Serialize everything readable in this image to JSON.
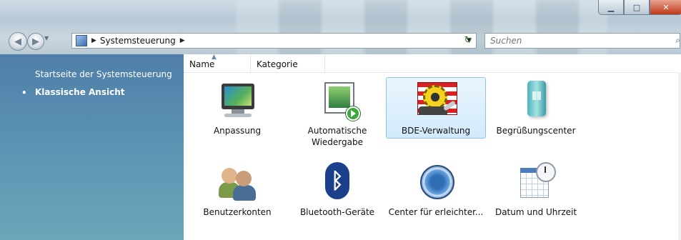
{
  "window": {
    "controls": [
      "minimize",
      "maximize",
      "close"
    ]
  },
  "nav": {
    "breadcrumb": "Systemsteuerung",
    "search_placeholder": "Suchen"
  },
  "sidebar": {
    "home_link": "Startseite der Systemsteuerung",
    "bullet": "•",
    "classic_view": "Klassische Ansicht"
  },
  "columns": {
    "name": "Name",
    "category": "Kategorie"
  },
  "items": [
    {
      "label": "Anpassung",
      "icon": "display-personalization-icon"
    },
    {
      "label": "Automatische Wiedergabe",
      "icon": "autoplay-icon"
    },
    {
      "label": "BDE-Verwaltung",
      "icon": "bde-admin-icon",
      "selected": true
    },
    {
      "label": "Begrüßungscenter",
      "icon": "welcome-center-icon"
    },
    {
      "label": "Benutzerkonten",
      "icon": "user-accounts-icon"
    },
    {
      "label": "Bluetooth-Geräte",
      "icon": "bluetooth-icon"
    },
    {
      "label": "Center für erleichter...",
      "icon": "ease-of-access-icon"
    },
    {
      "label": "Datum und Uhrzeit",
      "icon": "date-time-icon"
    }
  ],
  "colors": {
    "sidebar_top": "#4f7ea8",
    "sidebar_bottom": "#6ca5b9",
    "selection": "#d2eafb"
  }
}
